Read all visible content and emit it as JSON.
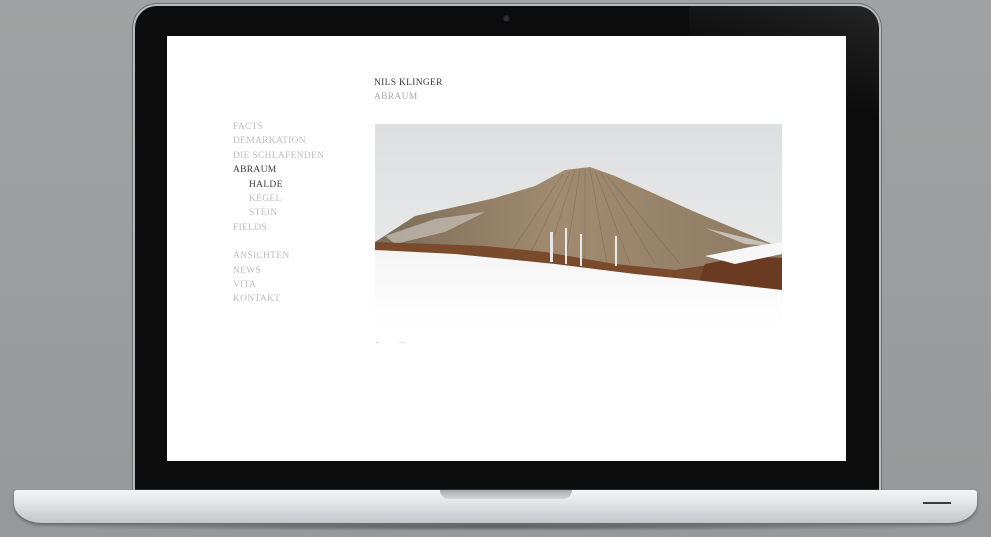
{
  "site": {
    "title": "NILS KLINGER",
    "subtitle": "ABRAUM"
  },
  "nav": {
    "items": [
      {
        "label": "FACTS",
        "active": false,
        "sub": false
      },
      {
        "label": "DEMARKATION",
        "active": false,
        "sub": false
      },
      {
        "label": "DIE SCHLAFENDEN",
        "active": false,
        "sub": false
      },
      {
        "label": "ABRAUM",
        "active": true,
        "sub": false
      },
      {
        "label": "HALDE",
        "active": true,
        "sub": true
      },
      {
        "label": "KEGEL",
        "active": false,
        "sub": true
      },
      {
        "label": "STEIN",
        "active": false,
        "sub": true
      },
      {
        "label": "FIELDS",
        "active": false,
        "sub": false
      },
      {
        "label": "ANSICHTEN",
        "active": false,
        "sub": false
      },
      {
        "label": "NEWS",
        "active": false,
        "sub": false
      },
      {
        "label": "VITA",
        "active": false,
        "sub": false
      },
      {
        "label": "KONTAKT",
        "active": false,
        "sub": false
      }
    ]
  },
  "photo": {
    "subject": "snow-covered slag heap"
  },
  "pager": {
    "prev": "←",
    "next": "→"
  },
  "colors": {
    "active_text": "#3a3a3a",
    "inactive_text": "#bdbdbd",
    "background": "#ffffff",
    "frame": "#0c0c0d"
  }
}
